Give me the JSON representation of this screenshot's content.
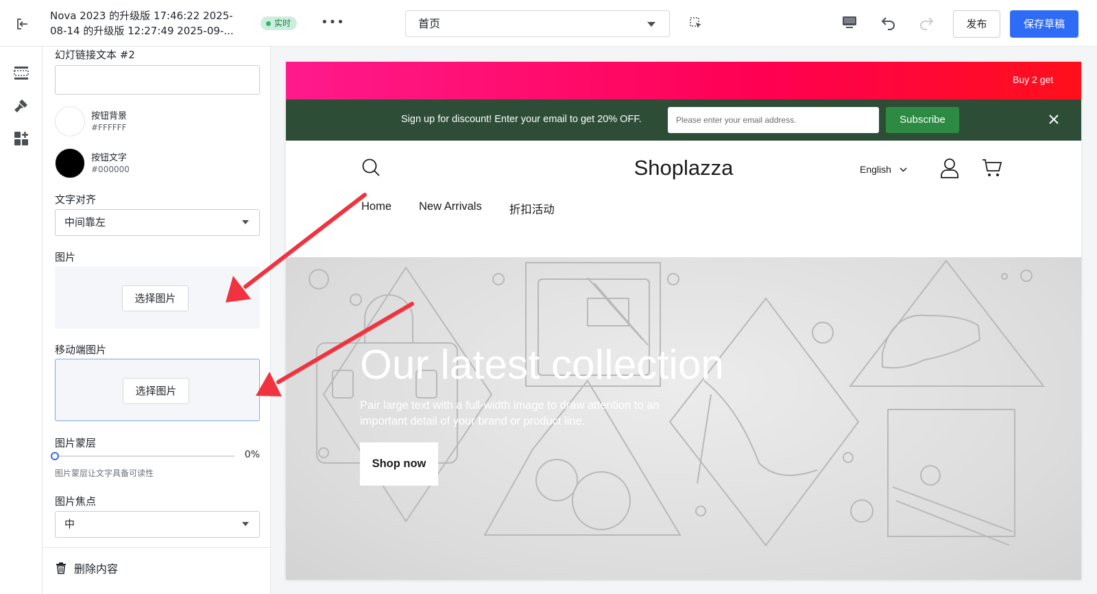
{
  "topbar": {
    "theme_title": "Nova 2023 的升级版 17:46:22 2025-08-14 的升级版 12:27:49 2025-09-...",
    "live_badge": "实时",
    "more": "•••",
    "page_select": "首页",
    "publish": "发布",
    "save_draft": "保存草稿"
  },
  "settings": {
    "slide_link_text_label": "幻灯链接文本 #2",
    "slide_link_text_value": "",
    "button_bg": {
      "label": "按钮背景",
      "value": "#FFFFFF",
      "color": "#FFFFFF"
    },
    "button_text": {
      "label": "按钮文字",
      "value": "#000000",
      "color": "#000000"
    },
    "text_align_label": "文字对齐",
    "text_align_value": "中间靠左",
    "image_label": "图片",
    "choose_image": "选择图片",
    "mobile_image_label": "移动端图片",
    "mobile_choose_image": "选择图片",
    "overlay_label": "图片蒙层",
    "overlay_value": "0%",
    "overlay_fraction": 0,
    "overlay_hint": "图片蒙层让文字具备可读性",
    "focal_label": "图片焦点",
    "focal_value": "中",
    "delete": "删除内容"
  },
  "preview": {
    "announcement": "Buy 2 get",
    "signup_text": "Sign up for discount! Enter your email to get 20% OFF.",
    "email_placeholder": "Please enter your email address.",
    "subscribe": "Subscribe",
    "logo": "Shoplazza",
    "language": "English",
    "nav": [
      "Home",
      "New Arrivals",
      "折扣活动"
    ],
    "hero_title": "Our latest collection",
    "hero_subtitle": "Pair large text with a full-width image to draw attention to an important detail of your brand or product line.",
    "hero_button": "Shop now"
  },
  "colors": {
    "accent_blue": "#2F6CF6",
    "live_green": "#2FB56A",
    "signup_bar": "#2E4D36",
    "subscribe_green": "#2C8A42",
    "annotation_red": "#F0333F"
  }
}
